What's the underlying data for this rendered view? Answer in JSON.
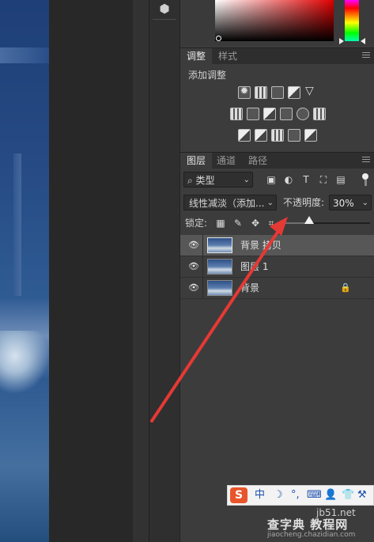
{
  "adjustments_panel": {
    "tabs": [
      "调整",
      "样式"
    ],
    "title": "添加调整"
  },
  "layers_panel": {
    "tabs": [
      "图层",
      "通道",
      "路径"
    ],
    "filter_kind": "类型",
    "blend_mode": "线性减淡（添加...",
    "opacity_label": "不透明度:",
    "opacity_value": "30%",
    "opacity_percent": 30,
    "lock_label": "锁定:",
    "layers": [
      {
        "name": "背景 拷贝",
        "selected": true,
        "locked": false
      },
      {
        "name": "图层 1",
        "selected": false,
        "locked": false
      },
      {
        "name": "背景",
        "selected": false,
        "locked": true
      }
    ]
  },
  "ime_bar": {
    "logo": "S",
    "mode": "中",
    "items": [
      "☽",
      "°,",
      "⌨",
      "👤",
      "👕",
      "⚒"
    ]
  },
  "watermark": {
    "site": "jb51.net",
    "brand": "查字典 教程网",
    "url": "jiaocheng.chazidian.com"
  },
  "annotation": {
    "color": "#e53935"
  },
  "colors": {
    "panel_bg": "#3c3c3c",
    "selected_row": "#575757"
  }
}
